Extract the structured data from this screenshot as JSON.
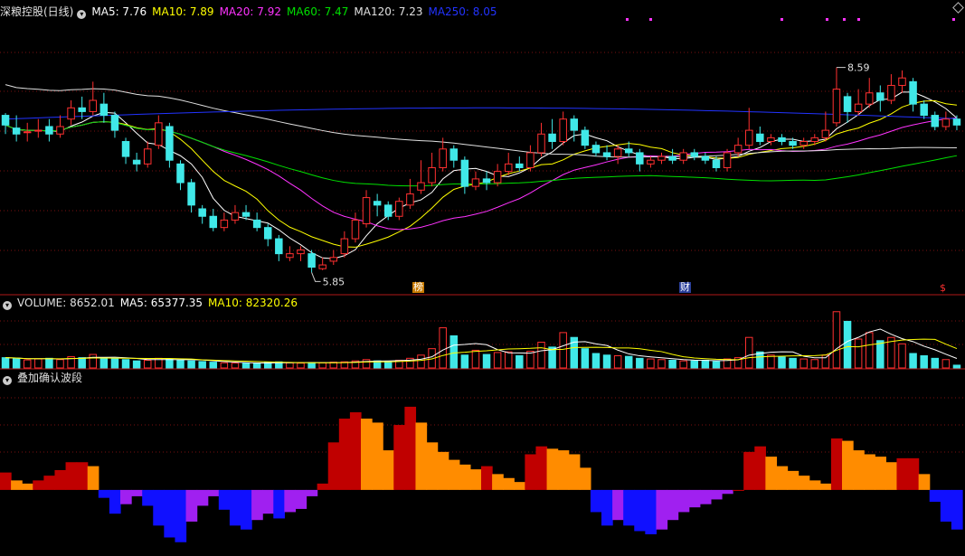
{
  "header": {
    "title": "深粮控股(日线)",
    "ma": [
      {
        "text": "MA5: 7.76",
        "color": "#ffffff"
      },
      {
        "text": "MA10: 7.89",
        "color": "#ffff00"
      },
      {
        "text": "MA20: 7.92",
        "color": "#ff33ff"
      },
      {
        "text": "MA60: 7.47",
        "color": "#00e000"
      },
      {
        "text": "MA120: 7.23",
        "color": "#e0e0e0"
      },
      {
        "text": "MA250: 8.05",
        "color": "#2233ff"
      }
    ]
  },
  "volume_header": [
    {
      "text": "VOLUME: 8652.01",
      "color": "#e0e0e0"
    },
    {
      "text": "MA5: 65377.35",
      "color": "#ffffff"
    },
    {
      "text": "MA10: 82320.26",
      "color": "#ffff00"
    }
  ],
  "indicator_header": {
    "title": "叠加确认波段"
  },
  "markers": {
    "bang": "榜",
    "cai": "财",
    "s": "$"
  },
  "chart_data": [
    {
      "type": "candlestick",
      "panel": "price",
      "ylim": [
        5.6,
        9.25
      ],
      "annotations": [
        {
          "text": "8.59",
          "index": 76
        },
        {
          "text": "5.85",
          "index": 28
        }
      ],
      "candles": [
        [
          7.95,
          7.82,
          7.98,
          7.7
        ],
        [
          7.78,
          7.7,
          7.95,
          7.6
        ],
        [
          7.72,
          7.73,
          7.85,
          7.6
        ],
        [
          7.75,
          7.75,
          7.9,
          7.65
        ],
        [
          7.8,
          7.7,
          7.9,
          7.6
        ],
        [
          7.7,
          7.8,
          7.95,
          7.65
        ],
        [
          7.9,
          8.05,
          8.15,
          7.82
        ],
        [
          8.05,
          8.0,
          8.2,
          7.9
        ],
        [
          8.0,
          8.15,
          8.4,
          7.95
        ],
        [
          8.1,
          7.95,
          8.25,
          7.85
        ],
        [
          7.95,
          7.75,
          8.0,
          7.65
        ],
        [
          7.6,
          7.4,
          7.65,
          7.3
        ],
        [
          7.35,
          7.3,
          7.45,
          7.2
        ],
        [
          7.3,
          7.5,
          7.6,
          7.25
        ],
        [
          7.55,
          7.85,
          7.95,
          7.5
        ],
        [
          7.8,
          7.35,
          7.85,
          7.25
        ],
        [
          7.3,
          7.05,
          7.35,
          6.95
        ],
        [
          7.05,
          6.75,
          7.1,
          6.65
        ],
        [
          6.7,
          6.6,
          6.75,
          6.5
        ],
        [
          6.6,
          6.45,
          6.7,
          6.4
        ],
        [
          6.45,
          6.55,
          6.65,
          6.4
        ],
        [
          6.55,
          6.65,
          6.75,
          6.5
        ],
        [
          6.65,
          6.6,
          6.75,
          6.55
        ],
        [
          6.55,
          6.45,
          6.65,
          6.4
        ],
        [
          6.45,
          6.3,
          6.5,
          6.2
        ],
        [
          6.3,
          6.1,
          6.35,
          6.0
        ],
        [
          6.05,
          6.1,
          6.2,
          6.0
        ],
        [
          6.1,
          6.15,
          6.2,
          6.0
        ],
        [
          6.1,
          5.92,
          6.15,
          5.85
        ],
        [
          5.9,
          5.95,
          6.05,
          5.88
        ],
        [
          6.0,
          6.05,
          6.15,
          5.95
        ],
        [
          6.1,
          6.3,
          6.4,
          6.05
        ],
        [
          6.3,
          6.55,
          6.65,
          6.25
        ],
        [
          6.5,
          6.85,
          6.95,
          6.45
        ],
        [
          6.8,
          6.75,
          6.9,
          6.6
        ],
        [
          6.75,
          6.6,
          6.8,
          6.55
        ],
        [
          6.6,
          6.8,
          6.85,
          6.55
        ],
        [
          6.75,
          6.9,
          7.1,
          6.7
        ],
        [
          6.95,
          7.05,
          7.35,
          6.9
        ],
        [
          7.05,
          7.25,
          7.45,
          7.0
        ],
        [
          7.25,
          7.5,
          7.65,
          7.2
        ],
        [
          7.5,
          7.35,
          7.55,
          7.25
        ],
        [
          7.35,
          7.0,
          7.4,
          6.9
        ],
        [
          7.0,
          7.1,
          7.2,
          6.95
        ],
        [
          7.1,
          7.05,
          7.2,
          6.95
        ],
        [
          7.05,
          7.2,
          7.3,
          7.0
        ],
        [
          7.2,
          7.3,
          7.45,
          7.15
        ],
        [
          7.3,
          7.25,
          7.4,
          7.2
        ],
        [
          7.25,
          7.45,
          7.55,
          7.2
        ],
        [
          7.45,
          7.7,
          7.85,
          7.4
        ],
        [
          7.7,
          7.6,
          7.9,
          7.5
        ],
        [
          7.6,
          7.9,
          8.0,
          7.55
        ],
        [
          7.9,
          7.75,
          7.95,
          7.6
        ],
        [
          7.75,
          7.55,
          7.8,
          7.5
        ],
        [
          7.55,
          7.45,
          7.6,
          7.4
        ],
        [
          7.45,
          7.4,
          7.55,
          7.35
        ],
        [
          7.4,
          7.5,
          7.55,
          7.3
        ],
        [
          7.5,
          7.45,
          7.6,
          7.4
        ],
        [
          7.45,
          7.3,
          7.5,
          7.2
        ],
        [
          7.3,
          7.35,
          7.4,
          7.25
        ],
        [
          7.35,
          7.4,
          7.45,
          7.3
        ],
        [
          7.4,
          7.35,
          7.5,
          7.3
        ],
        [
          7.35,
          7.45,
          7.5,
          7.3
        ],
        [
          7.45,
          7.4,
          7.5,
          7.35
        ],
        [
          7.4,
          7.35,
          7.45,
          7.3
        ],
        [
          7.35,
          7.25,
          7.4,
          7.2
        ],
        [
          7.25,
          7.45,
          7.5,
          7.2
        ],
        [
          7.45,
          7.55,
          7.65,
          7.4
        ],
        [
          7.55,
          7.75,
          8.05,
          7.5
        ],
        [
          7.7,
          7.6,
          7.8,
          7.55
        ],
        [
          7.6,
          7.65,
          7.7,
          7.55
        ],
        [
          7.65,
          7.6,
          7.7,
          7.55
        ],
        [
          7.6,
          7.55,
          7.65,
          7.5
        ],
        [
          7.55,
          7.6,
          7.65,
          7.5
        ],
        [
          7.6,
          7.65,
          7.7,
          7.55
        ],
        [
          7.65,
          7.75,
          8.0,
          7.6
        ],
        [
          7.85,
          8.3,
          8.59,
          7.8
        ],
        [
          8.2,
          8.0,
          8.25,
          7.85
        ],
        [
          8.0,
          8.1,
          8.3,
          7.95
        ],
        [
          8.1,
          8.25,
          8.45,
          8.05
        ],
        [
          8.25,
          8.15,
          8.35,
          8.0
        ],
        [
          8.15,
          8.35,
          8.5,
          8.1
        ],
        [
          8.35,
          8.45,
          8.55,
          8.25
        ],
        [
          8.4,
          8.1,
          8.45,
          8.0
        ],
        [
          8.1,
          7.95,
          8.15,
          7.9
        ],
        [
          7.95,
          7.8,
          8.0,
          7.75
        ],
        [
          7.8,
          7.9,
          8.0,
          7.75
        ],
        [
          7.9,
          7.82,
          7.95,
          7.75
        ]
      ]
    },
    {
      "type": "bar",
      "panel": "volume",
      "ylim": [
        0,
        180000
      ],
      "values": [
        32000,
        30000,
        25000,
        28000,
        30000,
        26000,
        35000,
        32000,
        42000,
        30000,
        28000,
        26000,
        22000,
        24000,
        30000,
        28000,
        24000,
        22000,
        20000,
        18000,
        16000,
        15000,
        14000,
        15000,
        17000,
        19000,
        16000,
        15000,
        17000,
        16000,
        18000,
        19000,
        22000,
        26000,
        22000,
        20000,
        24000,
        30000,
        40000,
        60000,
        125000,
        100000,
        40000,
        55000,
        42000,
        48000,
        50000,
        38000,
        52000,
        80000,
        65000,
        110000,
        95000,
        60000,
        45000,
        40000,
        38000,
        36000,
        30000,
        28000,
        26000,
        24000,
        22000,
        22000,
        24000,
        20000,
        28000,
        32000,
        95000,
        50000,
        40000,
        34000,
        30000,
        28000,
        26000,
        40000,
        175000,
        145000,
        90000,
        110000,
        85000,
        95000,
        75000,
        45000,
        38000,
        30000,
        26000,
        8652
      ]
    },
    {
      "type": "bar",
      "panel": "indicator",
      "ylim": [
        -80,
        130
      ],
      "values": [
        22,
        12,
        8,
        12,
        18,
        25,
        35,
        35,
        30,
        -10,
        -30,
        -18,
        -8,
        -20,
        -45,
        -60,
        -66,
        -40,
        -20,
        -8,
        -25,
        -45,
        -50,
        -38,
        -30,
        -36,
        -28,
        -24,
        -8,
        8,
        60,
        90,
        98,
        90,
        85,
        50,
        82,
        105,
        85,
        60,
        48,
        38,
        32,
        26,
        30,
        20,
        15,
        10,
        45,
        55,
        52,
        50,
        45,
        28,
        -28,
        -45,
        -38,
        -45,
        -52,
        -56,
        -50,
        -38,
        -28,
        -22,
        -18,
        -12,
        -5,
        0,
        48,
        55,
        42,
        30,
        24,
        18,
        12,
        8,
        65,
        62,
        50,
        45,
        42,
        35,
        40,
        40,
        20,
        -15,
        -40,
        -50
      ]
    }
  ]
}
